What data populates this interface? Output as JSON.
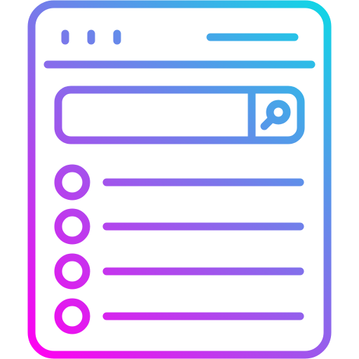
{
  "icon": {
    "name": "browser-search-list-icon",
    "gradient": {
      "start": "#ff00f0",
      "end": "#10d6e6"
    },
    "list_item_count": 4
  }
}
